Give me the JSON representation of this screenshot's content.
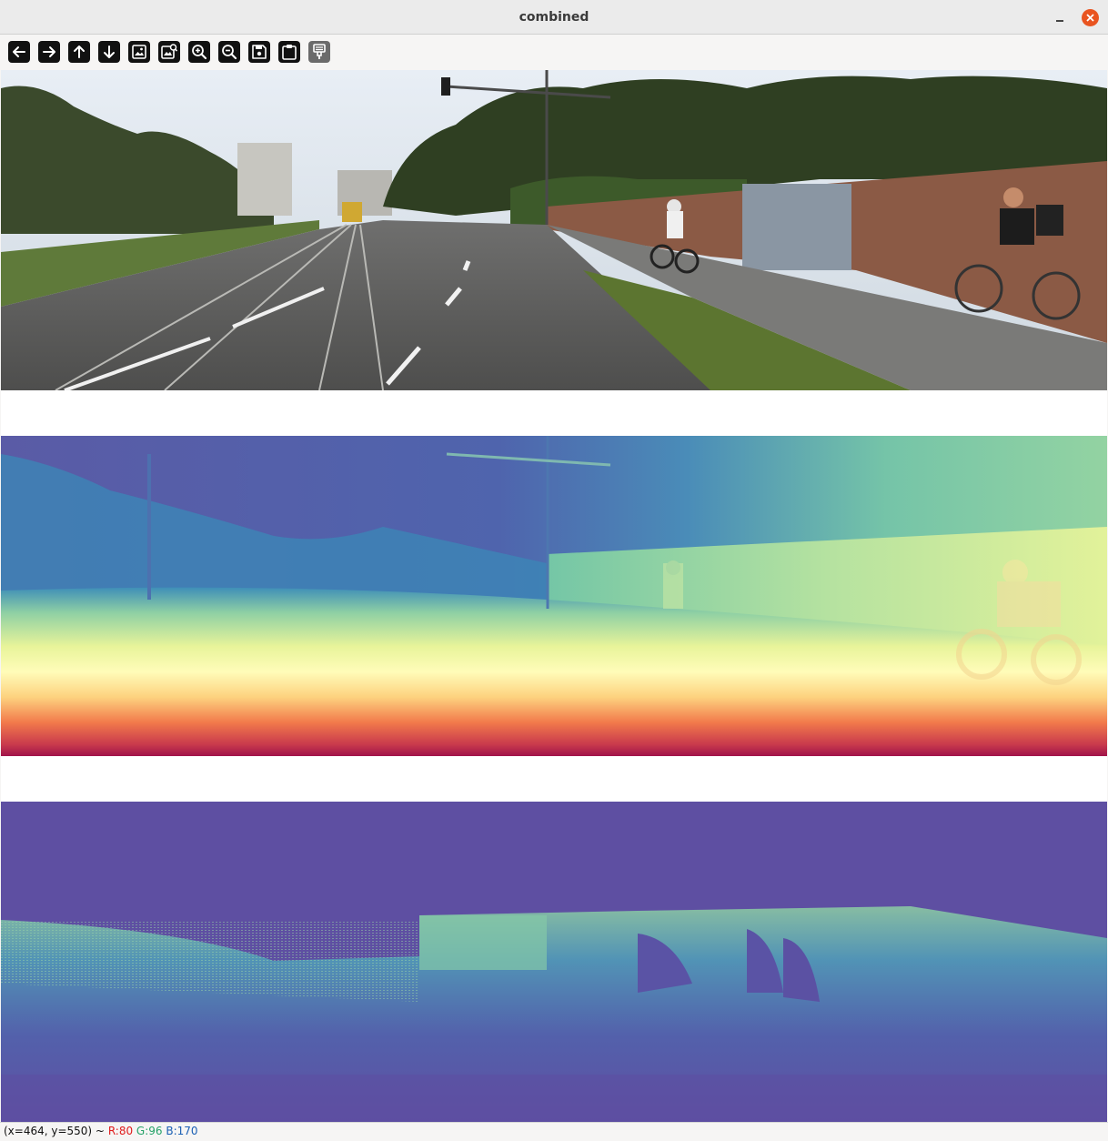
{
  "window": {
    "title": "combined"
  },
  "toolbar": {
    "buttons": [
      {
        "icon": "arrow-left-icon"
      },
      {
        "icon": "arrow-right-icon"
      },
      {
        "icon": "arrow-up-icon"
      },
      {
        "icon": "arrow-down-icon"
      },
      {
        "icon": "zoom-fit-image-icon"
      },
      {
        "icon": "image-properties-icon"
      },
      {
        "icon": "zoom-in-icon"
      },
      {
        "icon": "zoom-out-icon"
      },
      {
        "icon": "save-icon"
      },
      {
        "icon": "copy-to-clipboard-icon"
      },
      {
        "icon": "properties-brush-icon"
      }
    ]
  },
  "panels": [
    {
      "name": "rgb-image",
      "description_colors": {
        "sky": "#dfe6ee",
        "road": "#5a5f58"
      }
    },
    {
      "name": "depth-colormap",
      "colors": [
        "#5b57a4",
        "#3f8fb8",
        "#e8f49a",
        "#fdd27f",
        "#a0134a"
      ]
    },
    {
      "name": "lidar-sparse-depth",
      "background": "#5e4fa2"
    }
  ],
  "status": {
    "coords": "(x=464, y=550) ~",
    "r": "R:80",
    "g": "G:96",
    "b": "B:170"
  }
}
